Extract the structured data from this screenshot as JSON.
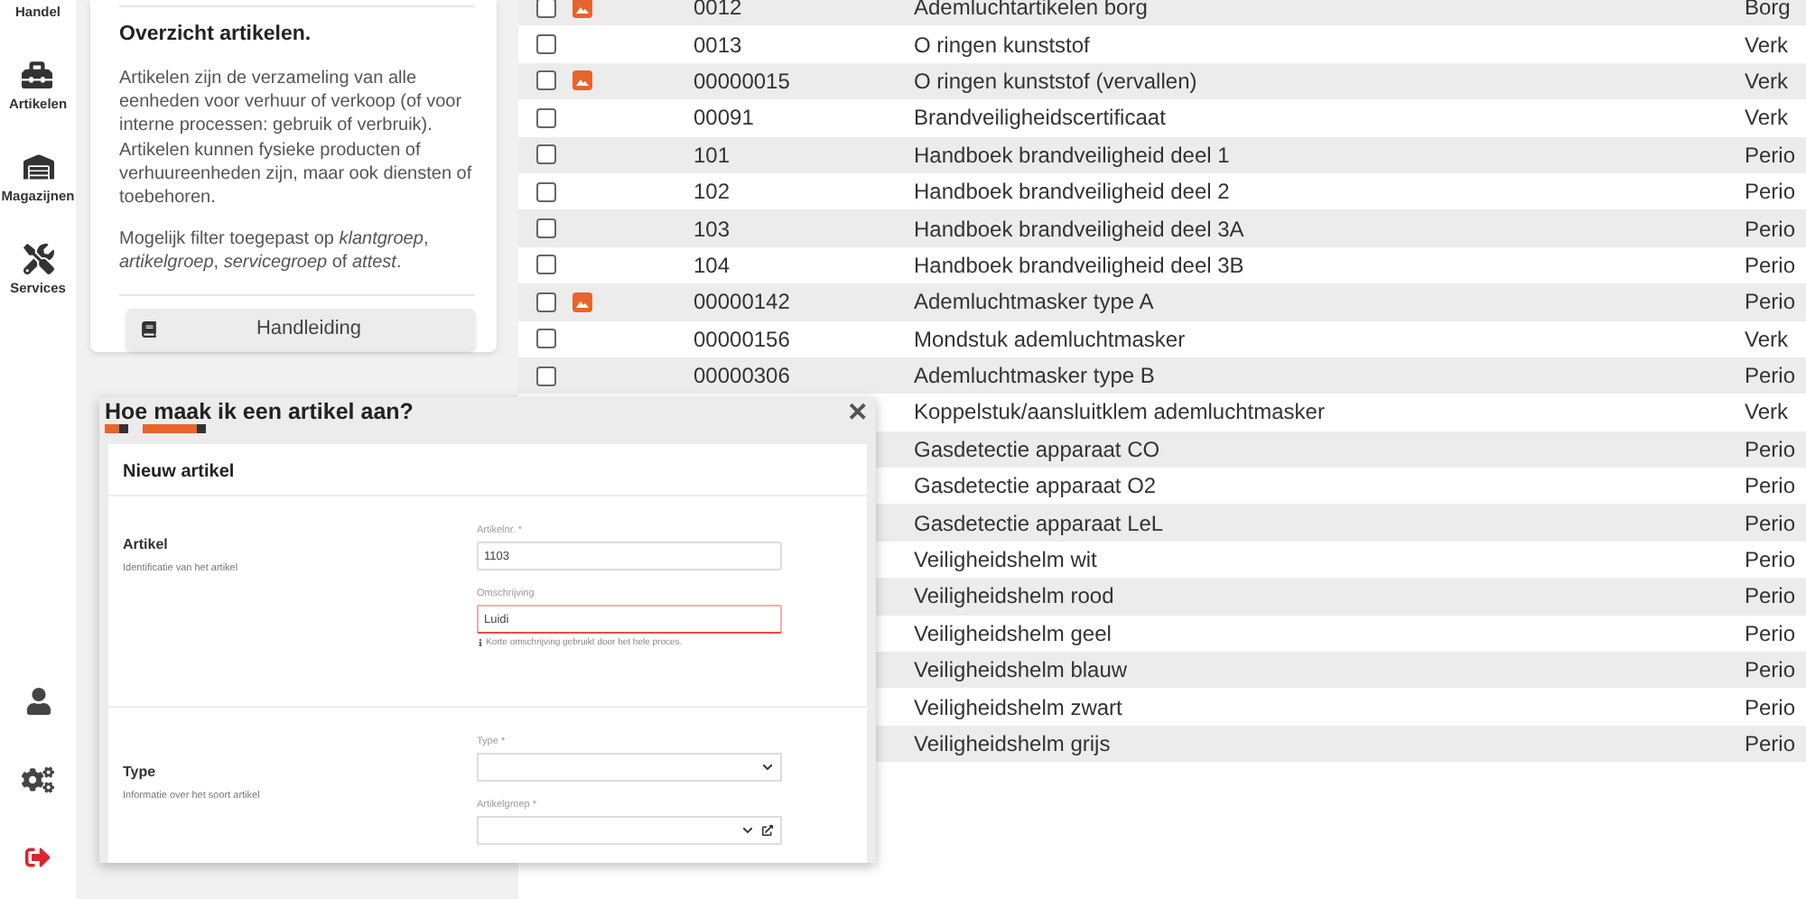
{
  "sidebar": {
    "items": [
      {
        "label": "Handel"
      },
      {
        "label": "Artikelen"
      },
      {
        "label": "Magazijnen"
      },
      {
        "label": "Services"
      }
    ]
  },
  "info_card": {
    "title": "Overzicht artikelen.",
    "paragraphs": [
      "Artikelen zijn de verzameling van alle eenheden voor verhuur of verkoop (of voor interne processen: gebruik of verbruik). Artikelen kunnen fysieke producten of verhuureenheden zijn, maar ook diensten of toebehoren.",
      "Mogelijk filter toegepast op *klantgroep*, *artikelgroep*, *servicegroep* of *attest*."
    ],
    "button": "Handleiding"
  },
  "table": {
    "rows": [
      {
        "kind": "full",
        "checked": false,
        "has_image": true,
        "code": "0012",
        "description": "Ademluchtartikelen borg",
        "type": "Borg"
      },
      {
        "kind": "full",
        "checked": false,
        "has_image": false,
        "code": "0013",
        "description": "O ringen kunststof",
        "type": "Verk"
      },
      {
        "kind": "full",
        "checked": false,
        "has_image": true,
        "code": "00000015",
        "description": "O ringen kunststof (vervallen)",
        "type": "Verk"
      },
      {
        "kind": "full",
        "checked": false,
        "has_image": false,
        "code": "00091",
        "description": "Brandveiligheidscertificaat",
        "type": "Verk"
      },
      {
        "kind": "full",
        "checked": false,
        "has_image": false,
        "code": "101",
        "description": "Handboek brandveiligheid deel 1",
        "type": "Perio"
      },
      {
        "kind": "full",
        "checked": false,
        "has_image": false,
        "code": "102",
        "description": "Handboek brandveiligheid deel 2",
        "type": "Perio"
      },
      {
        "kind": "full",
        "checked": false,
        "has_image": false,
        "code": "103",
        "description": "Handboek brandveiligheid deel 3A",
        "type": "Perio"
      },
      {
        "kind": "full",
        "checked": false,
        "has_image": false,
        "code": "104",
        "description": "Handboek brandveiligheid deel 3B",
        "type": "Perio"
      },
      {
        "kind": "full",
        "checked": false,
        "has_image": true,
        "code": "00000142",
        "description": "Ademluchtmasker type A",
        "type": "Perio"
      },
      {
        "kind": "full",
        "checked": false,
        "has_image": false,
        "code": "00000156",
        "description": "Mondstuk ademluchtmasker",
        "type": "Verk"
      },
      {
        "kind": "full",
        "checked": false,
        "has_image": false,
        "code": "00000306",
        "description": "Ademluchtmasker type B",
        "type": "Perio"
      },
      {
        "kind": "covered",
        "description": "Koppelstuk/aansluitklem ademluchtmasker",
        "type": "Verk"
      },
      {
        "kind": "covered",
        "description": "Gasdetectie apparaat CO",
        "type": "Perio"
      },
      {
        "kind": "covered",
        "description": "Gasdetectie apparaat O2",
        "type": "Perio"
      },
      {
        "kind": "covered",
        "description": "Gasdetectie apparaat LeL",
        "type": "Perio"
      },
      {
        "kind": "covered",
        "description": "Veiligheidshelm wit",
        "type": "Perio"
      },
      {
        "kind": "covered",
        "description": "Veiligheidshelm rood",
        "type": "Perio"
      },
      {
        "kind": "covered",
        "description": "Veiligheidshelm geel",
        "type": "Perio"
      },
      {
        "kind": "covered",
        "description": "Veiligheidshelm blauw",
        "type": "Perio"
      },
      {
        "kind": "covered",
        "description": "Veiligheidshelm zwart",
        "type": "Perio"
      },
      {
        "kind": "covered",
        "description": "Veiligheidshelm grijs",
        "type": "Perio"
      }
    ]
  },
  "popup": {
    "title": "Hoe maak ik een artikel aan?",
    "close": "✕",
    "form": {
      "title": "Nieuw artikel",
      "sections": [
        {
          "title": "Artikel",
          "subtitle": "Identificatie van het artikel",
          "fields": [
            {
              "kind": "input",
              "label": "Artikelnr. *",
              "value": "1103",
              "error": false
            },
            {
              "kind": "input",
              "label": "Omschrijving",
              "value": "Luidi",
              "error": true,
              "hint": "Korte omschrijving gebruikt door het hele proces."
            }
          ]
        },
        {
          "title": "Type",
          "subtitle": "Informatie over het soort artikel",
          "fields": [
            {
              "kind": "select",
              "label": "Type *",
              "link": false
            },
            {
              "kind": "select",
              "label": "Artikelgroep *",
              "link": true
            }
          ]
        }
      ]
    }
  }
}
